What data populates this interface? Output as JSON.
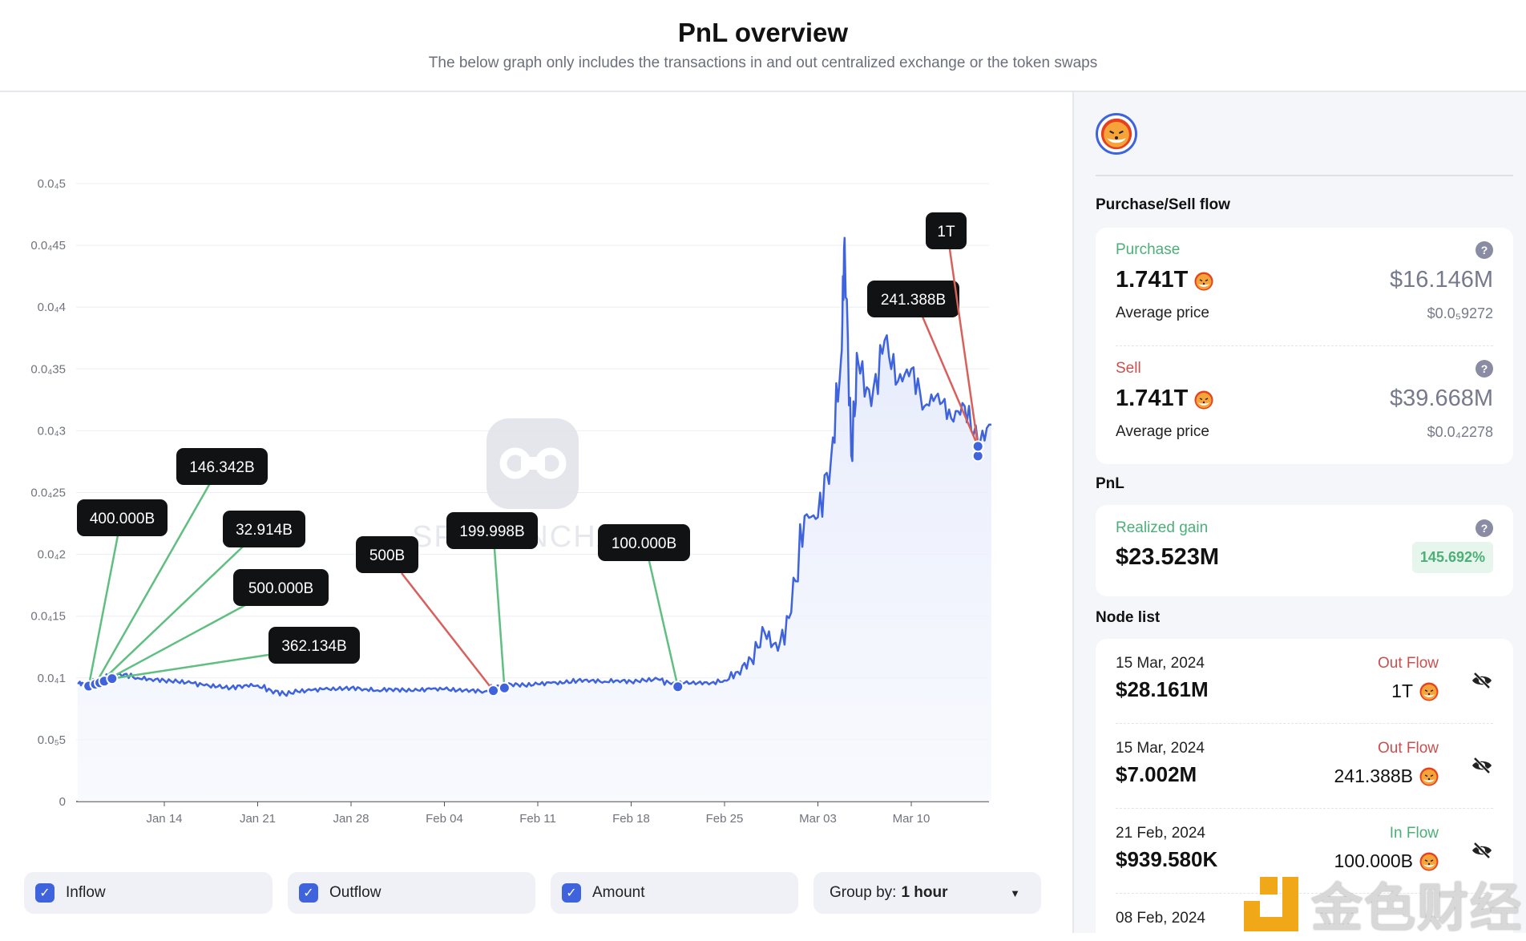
{
  "header": {
    "title": "PnL overview",
    "subtitle": "The below graph only includes the transactions in and out centralized exchange or the token swaps"
  },
  "chart_data": {
    "type": "line",
    "title": "",
    "xlabel": "",
    "ylabel": "",
    "ylim": [
      0,
      5e-05
    ],
    "grid": "horizontal",
    "line_color": "#3e63dd",
    "y_ticks": [
      {
        "v": 5e-05,
        "label": "0.0₄5"
      },
      {
        "v": 4.5e-05,
        "label": "0.0₄45"
      },
      {
        "v": 4e-05,
        "label": "0.0₄4"
      },
      {
        "v": 3.5e-05,
        "label": "0.0₄35"
      },
      {
        "v": 3e-05,
        "label": "0.0₄3"
      },
      {
        "v": 2.5e-05,
        "label": "0.0₄25"
      },
      {
        "v": 2e-05,
        "label": "0.0₄2"
      },
      {
        "v": 1.5e-05,
        "label": "0.0₄15"
      },
      {
        "v": 1e-05,
        "label": "0.0₄1"
      },
      {
        "v": 5e-06,
        "label": "0.0₅5"
      },
      {
        "v": 0,
        "label": "0"
      }
    ],
    "x_ticks": [
      {
        "date": "2024-01-14",
        "label": "Jan 14"
      },
      {
        "date": "2024-01-21",
        "label": "Jan 21"
      },
      {
        "date": "2024-01-28",
        "label": "Jan 28"
      },
      {
        "date": "2024-02-04",
        "label": "Feb 04"
      },
      {
        "date": "2024-02-11",
        "label": "Feb 11"
      },
      {
        "date": "2024-02-18",
        "label": "Feb 18"
      },
      {
        "date": "2024-02-25",
        "label": "Feb 25"
      },
      {
        "date": "2024-03-03",
        "label": "Mar 03"
      },
      {
        "date": "2024-03-10",
        "label": "Mar 10"
      }
    ],
    "xlim": [
      "2024-01-07T10:00",
      "2024-03-16T00:00"
    ],
    "series": [
      {
        "points": [
          [
            "2024-01-07T12:00",
            9.6e-06
          ],
          [
            "2024-01-08",
            9.5e-06
          ],
          [
            "2024-01-09",
            9.8e-06
          ],
          [
            "2024-01-10",
            1.02e-05
          ],
          [
            "2024-01-11",
            1.03e-05
          ],
          [
            "2024-01-12",
            1e-05
          ],
          [
            "2024-01-13",
            9.9e-06
          ],
          [
            "2024-01-14",
            9.8e-06
          ],
          [
            "2024-01-15",
            9.7e-06
          ],
          [
            "2024-01-16",
            9.6e-06
          ],
          [
            "2024-01-17",
            9.4e-06
          ],
          [
            "2024-01-18",
            9.3e-06
          ],
          [
            "2024-01-19",
            9.2e-06
          ],
          [
            "2024-01-20",
            9.4e-06
          ],
          [
            "2024-01-21",
            9.4e-06
          ],
          [
            "2024-01-22",
            9e-06
          ],
          [
            "2024-01-23",
            8.7e-06
          ],
          [
            "2024-01-24",
            8.9e-06
          ],
          [
            "2024-01-25",
            9e-06
          ],
          [
            "2024-01-26",
            9.1e-06
          ],
          [
            "2024-01-27",
            9.1e-06
          ],
          [
            "2024-01-28",
            9.2e-06
          ],
          [
            "2024-01-29",
            9.1e-06
          ],
          [
            "2024-01-30",
            9e-06
          ],
          [
            "2024-01-31",
            9.1e-06
          ],
          [
            "2024-02-01",
            9e-06
          ],
          [
            "2024-02-02",
            9e-06
          ],
          [
            "2024-02-03",
            9.1e-06
          ],
          [
            "2024-02-04",
            9.1e-06
          ],
          [
            "2024-02-05",
            9e-06
          ],
          [
            "2024-02-06",
            9e-06
          ],
          [
            "2024-02-07",
            8.9e-06
          ],
          [
            "2024-02-08",
            9.4e-06
          ],
          [
            "2024-02-09",
            9.5e-06
          ],
          [
            "2024-02-10",
            9.4e-06
          ],
          [
            "2024-02-11",
            9.5e-06
          ],
          [
            "2024-02-12",
            9.6e-06
          ],
          [
            "2024-02-13",
            9.6e-06
          ],
          [
            "2024-02-14",
            9.8e-06
          ],
          [
            "2024-02-15",
            9.8e-06
          ],
          [
            "2024-02-16",
            9.7e-06
          ],
          [
            "2024-02-17",
            9.8e-06
          ],
          [
            "2024-02-18",
            9.7e-06
          ],
          [
            "2024-02-19",
            9.8e-06
          ],
          [
            "2024-02-20",
            9.9e-06
          ],
          [
            "2024-02-21",
            9.5e-06
          ],
          [
            "2024-02-22",
            9.6e-06
          ],
          [
            "2024-02-23",
            9.6e-06
          ],
          [
            "2024-02-24",
            9.6e-06
          ],
          [
            "2024-02-25",
            9.8e-06
          ],
          [
            "2024-02-26",
            1.05e-05
          ],
          [
            "2024-02-27",
            1.15e-05
          ],
          [
            "2024-02-28",
            1.37e-05
          ],
          [
            "2024-02-29",
            1.22e-05
          ],
          [
            "2024-03-01",
            1.53e-05
          ],
          [
            "2024-03-02",
            2.31e-05
          ],
          [
            "2024-03-03",
            2.3e-05
          ],
          [
            "2024-03-04",
            2.79e-05
          ],
          [
            "2024-03-04T18:00",
            3.6e-05
          ],
          [
            "2024-03-05",
            4.56e-05
          ],
          [
            "2024-03-05T12:00",
            2.8e-05
          ],
          [
            "2024-03-06",
            3.57e-05
          ],
          [
            "2024-03-07",
            3.2e-05
          ],
          [
            "2024-03-08",
            3.73e-05
          ],
          [
            "2024-03-09",
            3.4e-05
          ],
          [
            "2024-03-10",
            3.5e-05
          ],
          [
            "2024-03-11",
            3.2e-05
          ],
          [
            "2024-03-12",
            3.3e-05
          ],
          [
            "2024-03-13",
            3.1e-05
          ],
          [
            "2024-03-14",
            3.2e-05
          ],
          [
            "2024-03-15",
            2.9e-05
          ],
          [
            "2024-03-16",
            3.05e-05
          ]
        ]
      }
    ],
    "annotations": [
      {
        "label": "400.000B",
        "date": "2024-01-08T08:00",
        "flow": "inflow"
      },
      {
        "label": "146.342B",
        "date": "2024-01-08T20:00",
        "flow": "inflow"
      },
      {
        "label": "32.914B",
        "date": "2024-01-09T04:00",
        "flow": "inflow"
      },
      {
        "label": "500.000B",
        "date": "2024-01-09T12:00",
        "flow": "inflow"
      },
      {
        "label": "362.134B",
        "date": "2024-01-10T02:00",
        "flow": "inflow"
      },
      {
        "label": "500B",
        "date": "2024-02-07T16:00",
        "flow": "outflow"
      },
      {
        "label": "199.998B",
        "date": "2024-02-08T12:00",
        "flow": "inflow"
      },
      {
        "label": "100.000B",
        "date": "2024-02-21T12:00",
        "flow": "inflow"
      },
      {
        "label": "241.388B",
        "date": "2024-03-15",
        "flow": "outflow"
      },
      {
        "label": "1T",
        "date": "2024-03-15",
        "flow": "outflow"
      }
    ],
    "colors": {
      "inflow": "#5fbf80",
      "outflow": "#d9605a",
      "line": "#3e63dd"
    }
  },
  "controls": {
    "inflow": {
      "label": "Inflow",
      "checked": true
    },
    "outflow": {
      "label": "Outflow",
      "checked": true
    },
    "amount": {
      "label": "Amount",
      "checked": true
    },
    "group_by": {
      "label": "Group by:",
      "value": "1 hour"
    }
  },
  "panel": {
    "flow_title": "Purchase/Sell flow",
    "purchase": {
      "label": "Purchase",
      "amount": "1.741T",
      "usd": "$16.146M",
      "avg_label": "Average price",
      "avg": "$0.0₅9272"
    },
    "sell": {
      "label": "Sell",
      "amount": "1.741T",
      "usd": "$39.668M",
      "avg_label": "Average price",
      "avg": "$0.0₄2278"
    },
    "pnl_title": "PnL",
    "pnl": {
      "label": "Realized gain",
      "value": "$23.523M",
      "pct": "145.692%"
    },
    "node_title": "Node list",
    "nodes": [
      {
        "date": "15 Mar, 2024",
        "usd": "$28.161M",
        "type": "Out Flow",
        "amount": "1T"
      },
      {
        "date": "15 Mar, 2024",
        "usd": "$7.002M",
        "type": "Out Flow",
        "amount": "241.388B"
      },
      {
        "date": "21 Feb, 2024",
        "usd": "$939.580K",
        "type": "In Flow",
        "amount": "100.000B"
      },
      {
        "date": "08 Feb, 2024",
        "usd": "",
        "type": "",
        "amount": ""
      }
    ]
  },
  "watermarks": {
    "center": "SPOTONCHAIN",
    "corner": "金色财经"
  }
}
